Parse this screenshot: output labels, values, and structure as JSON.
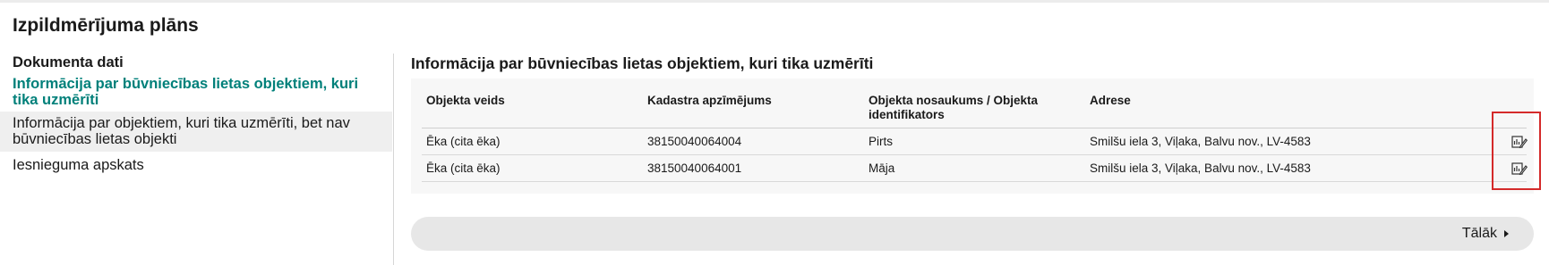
{
  "page": {
    "title": "Izpildmērījuma plāns"
  },
  "sidebar": {
    "heading": "Dokumenta dati",
    "items": [
      {
        "label": "Informācija par būvniecības lietas objektiem, kuri tika uzmērīti",
        "state": "active"
      },
      {
        "label": "Informācija par objektiem, kuri tika uzmērīti, bet nav būvniecības lietas objekti",
        "state": "shaded"
      },
      {
        "label": "Iesnieguma apskats",
        "state": "default"
      }
    ]
  },
  "main": {
    "section_title": "Informācija par būvniecības lietas objektiem, kuri tika uzmērīti",
    "table": {
      "columns": [
        "Objekta veids",
        "Kadastra apzīmējums",
        "Objekta nosaukums / Objekta identifikators",
        "Adrese"
      ],
      "rows": [
        {
          "type": "Ēka (cita ēka)",
          "cadastre": "38150040064004",
          "name": "Pirts",
          "address": "Smilšu iela 3, Viļaka, Balvu nov., LV-4583",
          "action_icon": "edit-document-icon"
        },
        {
          "type": "Ēka (cita ēka)",
          "cadastre": "38150040064001",
          "name": "Māja",
          "address": "Smilšu iela 3, Viļaka, Balvu nov., LV-4583",
          "action_icon": "edit-document-icon"
        }
      ]
    },
    "next_label": "Tālāk",
    "next_icon": "caret-right-icon"
  },
  "colors": {
    "accent": "#00807a",
    "highlight_border": "#d42a2a",
    "panel_bg": "#f7f7f7",
    "shaded_item_bg": "#efefef",
    "next_bar_bg": "#e7e7e7"
  }
}
